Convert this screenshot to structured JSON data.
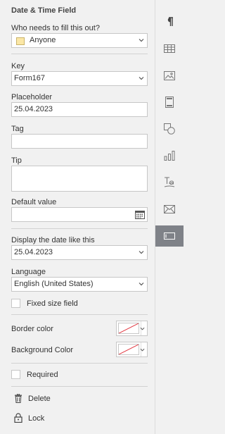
{
  "panel": {
    "title": "Date & Time Field",
    "who_label": "Who needs to fill this out?",
    "who_value": "Anyone",
    "key_label": "Key",
    "key_value": "Form167",
    "placeholder_label": "Placeholder",
    "placeholder_value": "25.04.2023",
    "tag_label": "Tag",
    "tag_value": "",
    "tip_label": "Tip",
    "tip_value": "",
    "default_label": "Default value",
    "default_value": "",
    "display_label": "Display the date like this",
    "display_value": "25.04.2023",
    "language_label": "Language",
    "language_value": "English (United States)",
    "fixed_size_label": "Fixed size field",
    "border_color_label": "Border color",
    "background_color_label": "Background Color",
    "required_label": "Required",
    "delete_label": "Delete",
    "lock_label": "Lock"
  },
  "colors": {
    "no_color_slash": "#e0303a",
    "active_rail": "#7f8288",
    "anyone_swatch": "#fbe7a6"
  },
  "rail": {
    "icons": [
      "paragraph-icon",
      "table-icon",
      "image-icon",
      "header-footer-icon",
      "shape-icon",
      "chart-icon",
      "text-art-icon",
      "mail-merge-icon",
      "form-field-icon"
    ],
    "active": "form-field-icon"
  }
}
